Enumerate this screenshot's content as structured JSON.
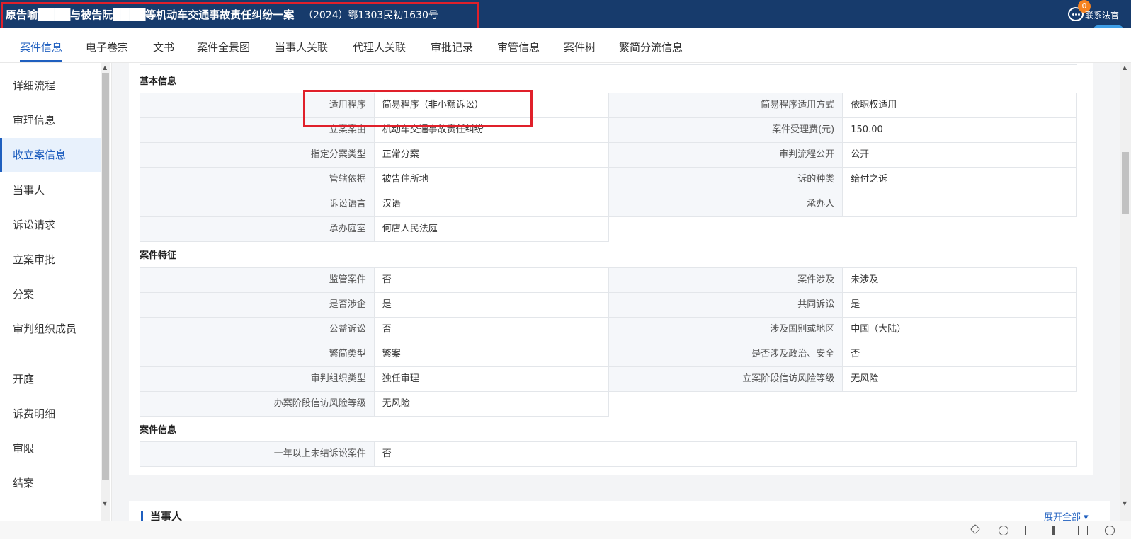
{
  "header": {
    "title": "原告喻████与被告阮████等机动车交通事故责任纠纷一案",
    "case_no": "（2024）鄂1303民初1630号",
    "contact_label": "联系法官",
    "badge_count": "0"
  },
  "tabs": [
    "案件信息",
    "电子卷宗",
    "文书",
    "案件全景图",
    "当事人关联",
    "代理人关联",
    "审批记录",
    "审管信息",
    "案件树",
    "繁简分流信息"
  ],
  "sidebar": [
    "详细流程",
    "审理信息",
    "收立案信息",
    "当事人",
    "诉讼请求",
    "立案审批",
    "分案",
    "审判组织成员",
    "开庭",
    "诉费明细",
    "审限",
    "结案"
  ],
  "sections": {
    "basic": {
      "title": "基本信息",
      "rows": [
        [
          {
            "label": "适用程序",
            "value": "简易程序（非小额诉讼）"
          },
          {
            "label": "简易程序适用方式",
            "value": "依职权适用"
          }
        ],
        [
          {
            "label": "立案案由",
            "value": "机动车交通事故责任纠纷"
          },
          {
            "label": "案件受理费(元)",
            "value": "150.00"
          }
        ],
        [
          {
            "label": "指定分案类型",
            "value": "正常分案"
          },
          {
            "label": "审判流程公开",
            "value": "公开"
          }
        ],
        [
          {
            "label": "管辖依据",
            "value": "被告住所地"
          },
          {
            "label": "诉的种类",
            "value": "给付之诉"
          }
        ],
        [
          {
            "label": "诉讼语言",
            "value": "汉语"
          },
          {
            "label": "承办人",
            "value": ""
          }
        ],
        [
          {
            "label": "承办庭室",
            "value": "何店人民法庭"
          }
        ]
      ]
    },
    "features": {
      "title": "案件特征",
      "rows": [
        [
          {
            "label": "监管案件",
            "value": "否"
          },
          {
            "label": "案件涉及",
            "value": "未涉及"
          }
        ],
        [
          {
            "label": "是否涉企",
            "value": "是"
          },
          {
            "label": "共同诉讼",
            "value": "是"
          }
        ],
        [
          {
            "label": "公益诉讼",
            "value": "否"
          },
          {
            "label": "涉及国别或地区",
            "value": "中国（大陆）"
          }
        ],
        [
          {
            "label": "繁简类型",
            "value": "繁案"
          },
          {
            "label": "是否涉及政治、安全",
            "value": "否"
          }
        ],
        [
          {
            "label": "审判组织类型",
            "value": "独任审理"
          },
          {
            "label": "立案阶段信访风险等级",
            "value": "无风险"
          }
        ],
        [
          {
            "label": "办案阶段信访风险等级",
            "value": "无风险"
          }
        ]
      ]
    },
    "caseinfo": {
      "title": "案件信息",
      "rows": [
        [
          {
            "label": "一年以上未结诉讼案件",
            "value": "否"
          }
        ]
      ]
    }
  },
  "party_section": {
    "title": "当事人",
    "expand_label": "展开全部 ▾"
  }
}
